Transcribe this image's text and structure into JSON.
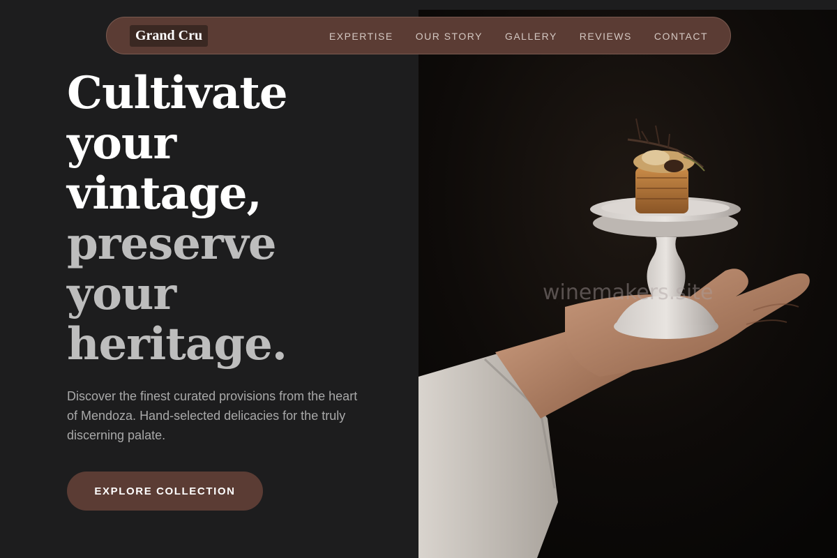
{
  "brand": {
    "logo": "Grand Cru"
  },
  "nav": {
    "items": [
      {
        "label": "EXPERTISE"
      },
      {
        "label": "OUR STORY"
      },
      {
        "label": "GALLERY"
      },
      {
        "label": "REVIEWS"
      },
      {
        "label": "CONTACT"
      }
    ]
  },
  "hero": {
    "headline_lines": [
      "Cultivate",
      "your",
      "vintage,",
      "preserve",
      "your",
      "heritage."
    ],
    "description": "Discover the finest curated provisions from the heart of Mendoza. Hand-selected delicacies for the truly discerning palate.",
    "cta_label": "EXPLORE COLLECTION"
  },
  "image": {
    "watermark": "winemakers.site"
  },
  "colors": {
    "background": "#1d1d1e",
    "accent": "#5b3c34",
    "heading": "#ffffff",
    "heading_muted": "#bdbdbd",
    "body_text": "#a9a9a9"
  }
}
